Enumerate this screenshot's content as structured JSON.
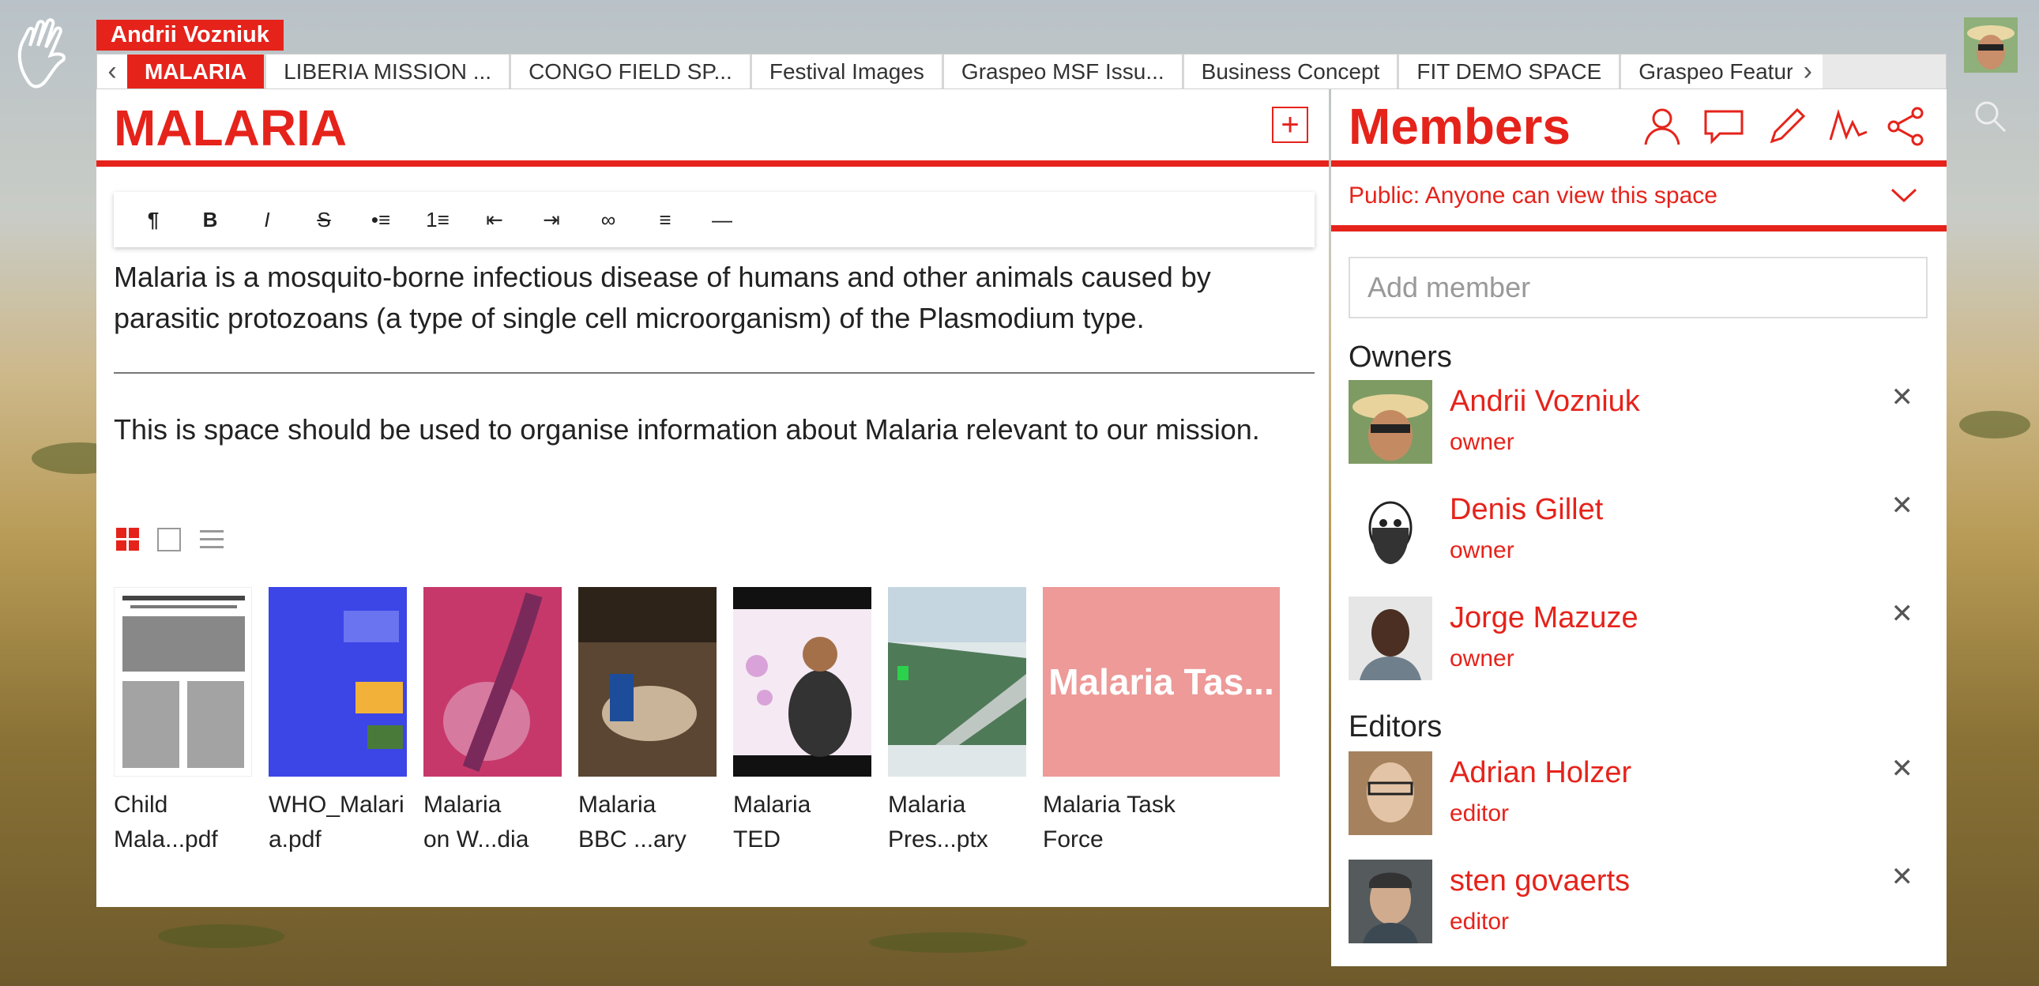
{
  "header": {
    "user_tag": "Andrii Vozniuk",
    "tabs": [
      {
        "label": "MALARIA",
        "active": true
      },
      {
        "label": "LIBERIA MISSION ..."
      },
      {
        "label": "CONGO FIELD SP..."
      },
      {
        "label": "Festival Images"
      },
      {
        "label": "Graspeo MSF Issu..."
      },
      {
        "label": "Business Concept"
      },
      {
        "label": "FIT DEMO SPACE"
      },
      {
        "label": "Graspeo Feature"
      }
    ],
    "icons": {
      "logo": "hand-logo-icon",
      "prev": "chevron-left-icon",
      "next": "chevron-right-icon",
      "search": "search-icon"
    }
  },
  "space": {
    "title": "MALARIA",
    "add_icon": "plus-square-icon",
    "toolbar": [
      "¶",
      "B",
      "I",
      "S",
      "•≡",
      "1≡",
      "⇤",
      "⇥",
      "∞",
      "≡",
      "—"
    ],
    "description_1": "Malaria is a mosquito-borne infectious disease of humans and other animals caused by parasitic protozoans (a type of single cell microorganism) of the Plasmodium type.",
    "description_2": "This is space should be used to organise information about Malaria relevant to our mission.",
    "view_icons": [
      "grid-view-icon",
      "single-view-icon",
      "list-view-icon"
    ],
    "files": [
      {
        "name": "Child\nMala...pdf"
      },
      {
        "name": "WHO_Malari\na.pdf"
      },
      {
        "name": "Malaria\non W...dia"
      },
      {
        "name": "Malaria\nBBC ...ary"
      },
      {
        "name": "Malaria\nTED"
      },
      {
        "name": "Malaria\nPres...ptx"
      },
      {
        "name": "Malaria Task\nForce",
        "thumb_text": "Malaria Tas..."
      }
    ]
  },
  "members": {
    "title": "Members",
    "header_icons": [
      "person-icon",
      "chat-icon",
      "pencil-icon",
      "activity-icon",
      "share-icon"
    ],
    "privacy": "Public: Anyone can view this space",
    "add_placeholder": "Add member",
    "owners_label": "Owners",
    "editors_label": "Editors",
    "owners": [
      {
        "name": "Andrii Vozniuk",
        "role": "owner"
      },
      {
        "name": "Denis Gillet",
        "role": "owner"
      },
      {
        "name": "Jorge Mazuze",
        "role": "owner"
      }
    ],
    "editors": [
      {
        "name": "Adrian Holzer",
        "role": "editor"
      },
      {
        "name": "sten govaerts",
        "role": "editor"
      }
    ]
  },
  "colors": {
    "accent": "#e5231b",
    "task_thumb": "#ed9a98"
  }
}
